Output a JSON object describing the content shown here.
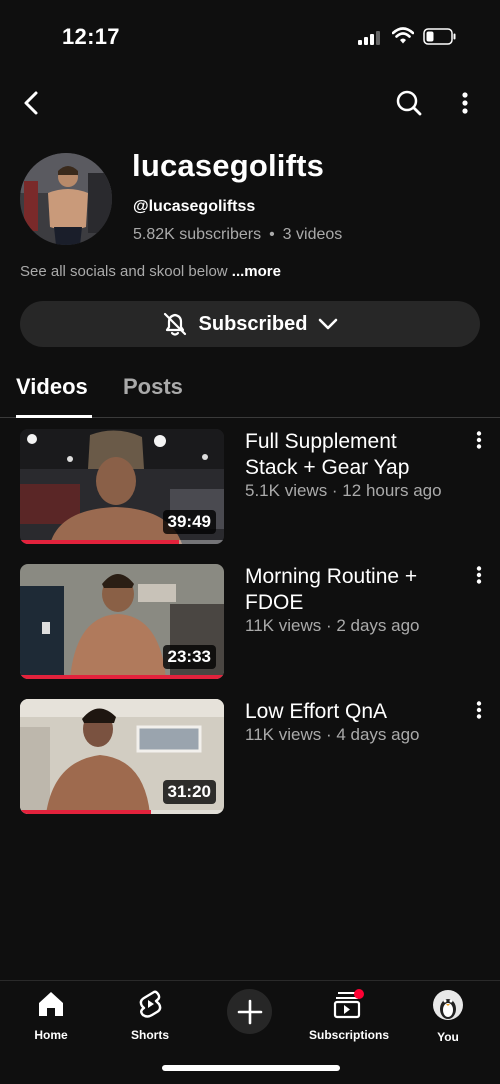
{
  "status_bar": {
    "time": "12:17"
  },
  "channel": {
    "name": "lucasegolifts",
    "handle": "@lucasegoliftss",
    "subscribers": "5.82K subscribers",
    "separator": "•",
    "videos_count": "3 videos",
    "description": "See all socials and skool below ",
    "more_label": "...more",
    "subscribe_label": "Subscribed"
  },
  "tabs": [
    {
      "label": "Videos",
      "active": true
    },
    {
      "label": "Posts",
      "active": false
    }
  ],
  "videos": [
    {
      "title": "Full Supplement Stack + Gear Yap",
      "meta": "5.1K views · 12 hours ago",
      "duration": "39:49",
      "watched_fraction": 0.78
    },
    {
      "title": "Morning Routine + FDOE",
      "meta": "11K views · 2 days ago",
      "duration": "23:33",
      "watched_fraction": 1.0
    },
    {
      "title": "Low Effort QnA",
      "meta": "11K views · 4 days ago",
      "duration": "31:20",
      "watched_fraction": 0.64
    }
  ],
  "bottom_nav": [
    {
      "label": "Home",
      "icon": "home-icon"
    },
    {
      "label": "Shorts",
      "icon": "shorts-icon"
    },
    {
      "label": "",
      "icon": "plus-icon"
    },
    {
      "label": "Subscriptions",
      "icon": "subscriptions-icon"
    },
    {
      "label": "You",
      "icon": "avatar-icon"
    }
  ],
  "colors": {
    "background": "#0f0f0f",
    "button_bg": "#272727",
    "muted_text": "#aaaaaa",
    "progress": "#e3223c"
  }
}
